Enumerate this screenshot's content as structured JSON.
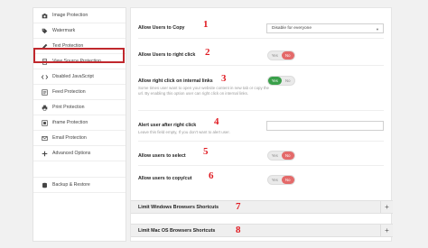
{
  "sidebar": {
    "items": [
      {
        "label": "Image Protection",
        "icon": "camera-icon"
      },
      {
        "label": "Watermark",
        "icon": "tag-icon"
      },
      {
        "label": "Text Protection",
        "icon": "pencil-icon"
      },
      {
        "label": "View Source Protection",
        "icon": "document-icon"
      },
      {
        "label": "Disabled JavaScript",
        "icon": "code-icon"
      },
      {
        "label": "Feed Protection",
        "icon": "feed-icon"
      },
      {
        "label": "Print Protection",
        "icon": "printer-icon"
      },
      {
        "label": "iframe Protection",
        "icon": "frame-icon"
      },
      {
        "label": "Email Protection",
        "icon": "envelope-icon"
      },
      {
        "label": "Advanced Options",
        "icon": "plus-icon"
      },
      {
        "label": "Backup & Restore",
        "icon": "database-icon"
      }
    ]
  },
  "settings": {
    "copy": {
      "label": "Allow Users to Copy",
      "value": "Disable for everyone",
      "num": "1"
    },
    "right_click": {
      "label": "Allow Users to right click",
      "yes": "Yes",
      "no": "No",
      "num": "2"
    },
    "internal_links": {
      "label": "Allow right click on internal links",
      "desc": "Some times user want to open your website content in new tab or copy the url. By enabling this option user can right click on internal links.",
      "yes": "Yes",
      "no": "No",
      "num": "3"
    },
    "alert": {
      "label": "Alert user after right click",
      "desc": "Leave this field empty, If you don't want to alert user.",
      "value": "",
      "num": "4"
    },
    "select": {
      "label": "Allow users to select",
      "yes": "Yes",
      "no": "No",
      "num": "5"
    },
    "copy_cut": {
      "label": "Allow users to copy/cut",
      "yes": "Yes",
      "no": "No",
      "num": "6"
    }
  },
  "accordions": [
    {
      "title": "Limit Windows Browsers Shortcuts",
      "num": "7",
      "plus": "+"
    },
    {
      "title": "Limit Mac OS Browsers Shortcuts",
      "num": "8",
      "plus": "+"
    }
  ],
  "colors": {
    "accent_red": "#e01b22",
    "toggle_off": "#e46a6a",
    "toggle_on": "#3aa04a",
    "highlight": "#c0282d"
  }
}
